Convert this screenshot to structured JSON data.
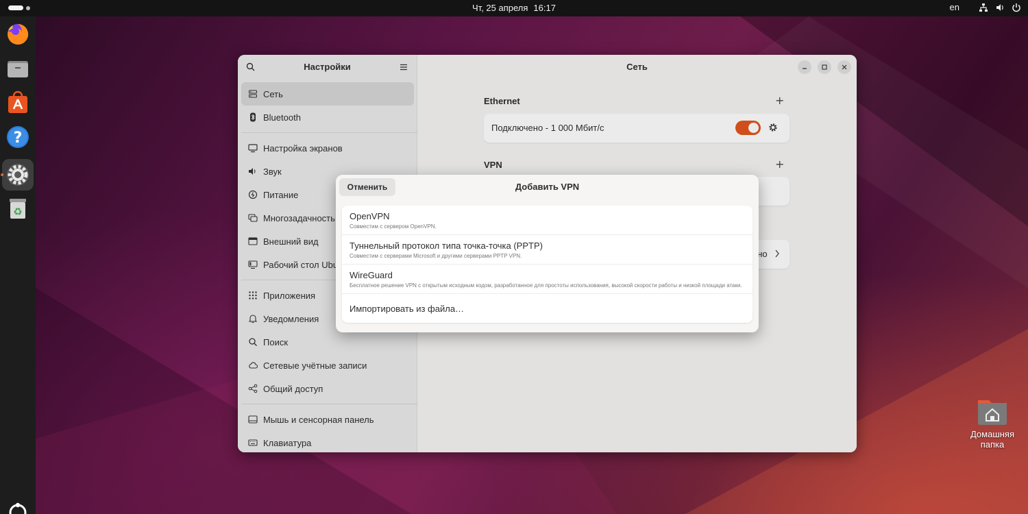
{
  "topbar": {
    "date": "Чт, 25 апреля",
    "time": "16:17",
    "language": "en"
  },
  "dock": {
    "items": [
      {
        "name": "firefox-icon"
      },
      {
        "name": "files-icon"
      },
      {
        "name": "app-center-icon"
      },
      {
        "name": "help-icon"
      },
      {
        "name": "settings-icon",
        "active": true
      },
      {
        "name": "trash-icon"
      }
    ]
  },
  "desktop": {
    "home_folder_label": "Домашняя папка"
  },
  "settings": {
    "sidebar_title": "Настройки",
    "items": [
      {
        "label": "Сеть",
        "icon": "network-icon",
        "selected": true
      },
      {
        "label": "Bluetooth",
        "icon": "bluetooth-icon"
      },
      {
        "label": "Настройка экранов",
        "icon": "display-icon"
      },
      {
        "label": "Звук",
        "icon": "sound-icon"
      },
      {
        "label": "Питание",
        "icon": "power-icon"
      },
      {
        "label": "Многозадачность",
        "icon": "multitasking-icon"
      },
      {
        "label": "Внешний вид",
        "icon": "appearance-icon"
      },
      {
        "label": "Рабочий стол Ubuntu",
        "icon": "desktop-icon"
      },
      {
        "label": "Приложения",
        "icon": "apps-icon"
      },
      {
        "label": "Уведомления",
        "icon": "bell-icon"
      },
      {
        "label": "Поиск",
        "icon": "search-icon"
      },
      {
        "label": "Сетевые учётные записи",
        "icon": "cloud-icon"
      },
      {
        "label": "Общий доступ",
        "icon": "share-icon"
      },
      {
        "label": "Мышь и сенсорная панель",
        "icon": "mouse-icon"
      },
      {
        "label": "Клавиатура",
        "icon": "keyboard-icon"
      }
    ],
    "page_title": "Сеть",
    "ethernet": {
      "label": "Ethernet",
      "status": "Подключено - 1 000 Мбит/с",
      "enabled": true
    },
    "vpn": {
      "label": "VPN"
    },
    "proxy_partial_value": "ено"
  },
  "dialog": {
    "title": "Добавить VPN",
    "cancel": "Отменить",
    "options": [
      {
        "name": "OpenVPN",
        "desc": "Совместим с сервером OpenVPN."
      },
      {
        "name": "Туннельный протокол типа точка-точка (PPTP)",
        "desc": "Совместим с серверами Microsoft и другими серверами PPTP VPN."
      },
      {
        "name": "WireGuard",
        "desc": "Бесплатное решение VPN с открытым исходным кодом, разработанное для простоты использования, высокой скорости работы и низкой площади атаки."
      },
      {
        "name": "Импортировать из файла…",
        "desc": ""
      }
    ]
  },
  "colors": {
    "accent": "#e95420",
    "toggle_on": "#e2551e"
  }
}
